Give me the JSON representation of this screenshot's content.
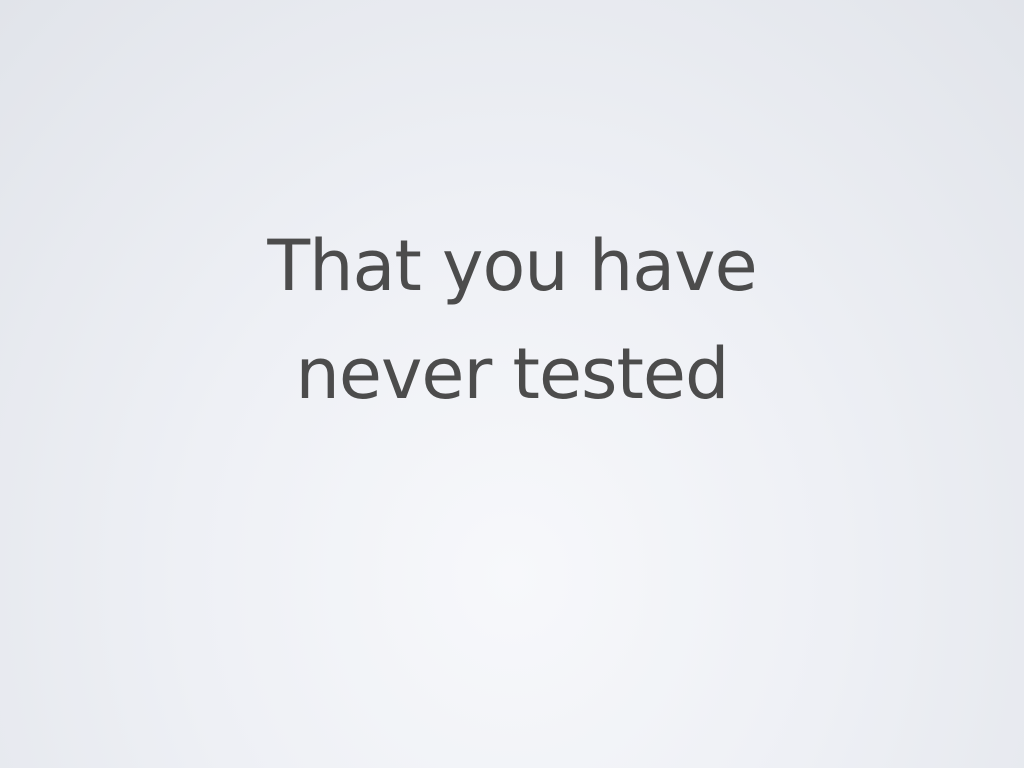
{
  "slide": {
    "title_lines": [
      "That you have",
      "never tested"
    ]
  },
  "colors": {
    "text": "#4c4c4c",
    "background_center": "#f7f8fb",
    "background_edge": "#e1e4ea"
  }
}
